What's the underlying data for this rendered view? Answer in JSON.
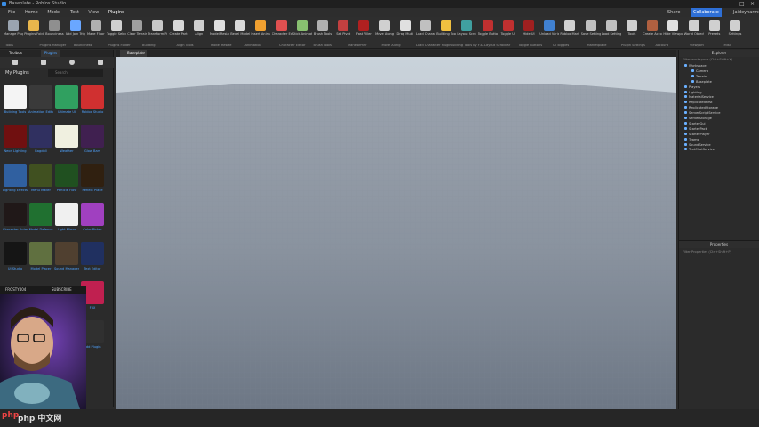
{
  "window": {
    "title": "Baseplate - Roblox Studio"
  },
  "menu": {
    "items": [
      "File",
      "Home",
      "Model",
      "Test",
      "View",
      "Plugins"
    ],
    "active": "Plugins",
    "share": "Share",
    "collaborate": "Collaborate",
    "user": "Jaideyharmon"
  },
  "ribbon": {
    "buttons": [
      {
        "label": "Manage Plugins",
        "icon": "gear-icon",
        "color": "#9aa4b0"
      },
      {
        "label": "Plugins Folder",
        "icon": "folder-icon",
        "color": "#e8b64c"
      },
      {
        "label": "Bounciness",
        "icon": "wave-icon",
        "color": "#8f8f8f"
      },
      {
        "label": "Add Join Trigger",
        "icon": "plus-icon",
        "color": "#6aa7ff"
      },
      {
        "label": "Make Floor",
        "icon": "cube-icon",
        "color": "#b0b0b0"
      },
      {
        "label": "Toggle Select",
        "icon": "cursor-icon",
        "color": "#d0d0d0"
      },
      {
        "label": "Clear Terrain",
        "icon": "terrain-icon",
        "color": "#a0a0a0"
      },
      {
        "label": "Transform Part",
        "icon": "transform-icon",
        "color": "#c9c9c9"
      },
      {
        "label": "Create Part",
        "icon": "part-icon",
        "color": "#d8d8d8"
      },
      {
        "label": "Align",
        "icon": "align-icon",
        "color": "#cfcfcf"
      },
      {
        "label": "Model Resize",
        "icon": "resize-icon",
        "color": "#e0e0e0"
      },
      {
        "label": "Bevel Model",
        "icon": "bevel-icon",
        "color": "#d9d9d9"
      },
      {
        "label": "Insert Animation",
        "icon": "animation-icon",
        "color": "#f0a030"
      },
      {
        "label": "Character Editor",
        "icon": "character-icon",
        "color": "#e05050"
      },
      {
        "label": "Stick Animation",
        "icon": "tree-icon",
        "color": "#88c070"
      },
      {
        "label": "Brush Tools",
        "icon": "brush-icon",
        "color": "#b0b0b0"
      },
      {
        "label": "Set Pivot",
        "icon": "pivot-icon",
        "color": "#c24040"
      },
      {
        "label": "Fast Filler",
        "icon": "filler-icon",
        "color": "#b02020"
      },
      {
        "label": "Move Along",
        "icon": "move-icon",
        "color": "#d0d0d0"
      },
      {
        "label": "Drag Multi",
        "icon": "drag-icon",
        "color": "#e0e0e0"
      },
      {
        "label": "Load Character Pro",
        "icon": "character-pro-icon",
        "color": "#c0c0c0"
      },
      {
        "label": "Building Tools by F3X",
        "icon": "f3x-icon",
        "color": "#f0c040"
      },
      {
        "label": "Layout Scrollbar",
        "icon": "layout-icon",
        "color": "#40a0a0"
      },
      {
        "label": "Toggle Buttons",
        "icon": "toggle-icon",
        "color": "#c03030"
      },
      {
        "label": "Toggle UI",
        "icon": "ui-icon",
        "color": "#c03030"
      },
      {
        "label": "Hide UI",
        "icon": "hide-icon",
        "color": "#a02020"
      },
      {
        "label": "Unload Variables",
        "icon": "unload-icon",
        "color": "#4080d0"
      },
      {
        "label": "Roblox Marketplace",
        "icon": "marketplace-icon",
        "color": "#d0d0d0"
      },
      {
        "label": "Save Settings",
        "icon": "save-icon",
        "color": "#c0c0c0"
      },
      {
        "label": "Load Settings",
        "icon": "load-icon",
        "color": "#c0c0c0"
      },
      {
        "label": "Tools",
        "icon": "tools-icon",
        "color": "#d0d0d0"
      },
      {
        "label": "Create Account",
        "icon": "account-icon",
        "color": "#b06040"
      },
      {
        "label": "Hide Viewport",
        "icon": "viewport-icon",
        "color": "#e0e0e0"
      },
      {
        "label": "World Objects",
        "icon": "world-icon",
        "color": "#d0d0d0"
      },
      {
        "label": "Presets",
        "icon": "presets-icon",
        "color": "#d0d0d0"
      },
      {
        "label": "Settings",
        "icon": "settings-icon",
        "color": "#d0d0d0"
      }
    ],
    "groups": [
      "Tools",
      "Plugins Manager",
      "Bounciness",
      "Plugins Folder",
      "Building",
      "Align Tools",
      "Model Resize",
      "Animation",
      "Character Editor",
      "Brush Tools",
      "Transformer",
      "Move Along",
      "Load Character Plugin",
      "Building Tools by F3X",
      "Layout Scrollbar",
      "Toggle Buttons",
      "UI Toggles",
      "Marketplace",
      "Plugin Settings",
      "Account",
      "Viewport",
      "Misc"
    ]
  },
  "left_panel": {
    "tabs": [
      "Toolbox",
      "Plugins"
    ],
    "active_tab": "Plugins",
    "heading": "My Plugins",
    "search_placeholder": "Search",
    "plugins": [
      {
        "name": "Building Tools",
        "color": "#f4f4f4"
      },
      {
        "name": "Animation Editor",
        "color": "#3a3a3a"
      },
      {
        "name": "Ultimate UI",
        "color": "#30a060"
      },
      {
        "name": "Roblox Studio",
        "color": "#d03030"
      },
      {
        "name": "Neon Lighting",
        "color": "#701010"
      },
      {
        "name": "Ragdoll",
        "color": "#303060"
      },
      {
        "name": "Weather",
        "color": "#f0f0e0"
      },
      {
        "name": "Glow Bars",
        "color": "#402050"
      },
      {
        "name": "Lighting Effects",
        "color": "#3060a0"
      },
      {
        "name": "Menu Maker",
        "color": "#405020"
      },
      {
        "name": "Particle Flow",
        "color": "#205020"
      },
      {
        "name": "Reflect Place",
        "color": "#302010"
      },
      {
        "name": "Character Animation",
        "color": "#201818"
      },
      {
        "name": "Model Defence",
        "color": "#207030"
      },
      {
        "name": "Light Mirror",
        "color": "#f0f0f0"
      },
      {
        "name": "Color Picker",
        "color": "#a040c0"
      },
      {
        "name": "UI Studio",
        "color": "#151515"
      },
      {
        "name": "Model Placer",
        "color": "#607040"
      },
      {
        "name": "Sound Manager",
        "color": "#504030"
      },
      {
        "name": "Text Editor",
        "color": "#203060"
      },
      {
        "name": "F3X",
        "color": "#c02050"
      },
      {
        "name": "Add Plugin",
        "color": "#303030"
      }
    ]
  },
  "webcam": {
    "label": "FROSTY404",
    "sublabel": "SUBSCRIBE"
  },
  "viewport": {
    "tab": "Baseplate"
  },
  "explorer": {
    "title": "Explorer",
    "filter": "Filter workspace (Ctrl+Shift+X)",
    "tree": [
      "Workspace",
      "Camera",
      "Terrain",
      "Baseplate",
      "Players",
      "Lighting",
      "MaterialService",
      "ReplicatedFirst",
      "ReplicatedStorage",
      "ServerScriptService",
      "ServerStorage",
      "StarterGui",
      "StarterPack",
      "StarterPlayer",
      "Teams",
      "SoundService",
      "TextChatService"
    ]
  },
  "properties": {
    "title": "Properties",
    "filter": "Filter Properties (Ctrl+Shift+P)"
  },
  "watermark": {
    "text": "php 中文网"
  }
}
